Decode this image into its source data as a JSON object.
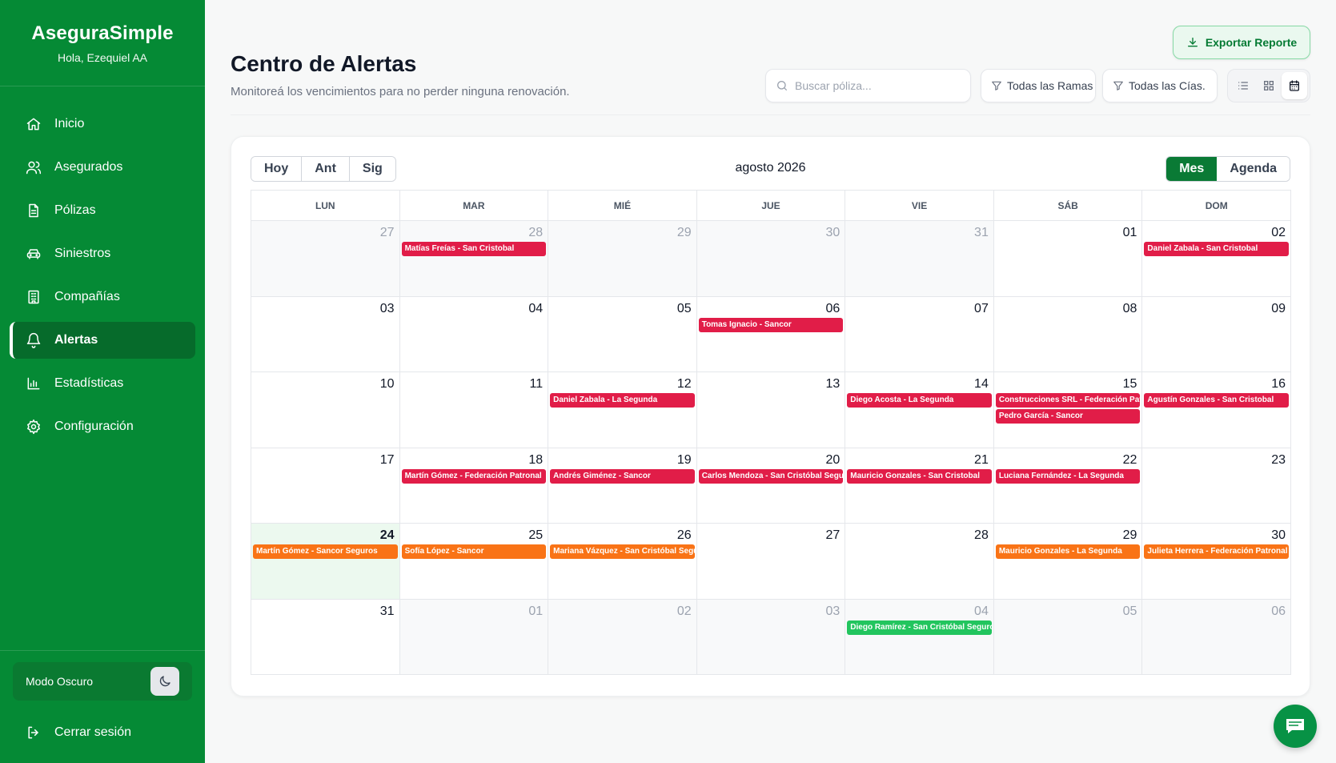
{
  "sidebar": {
    "brand": "AseguraSimple",
    "greeting": "Hola, Ezequiel AA",
    "items": [
      {
        "label": "Inicio",
        "icon": "home-icon"
      },
      {
        "label": "Asegurados",
        "icon": "users-icon"
      },
      {
        "label": "Pólizas",
        "icon": "document-icon"
      },
      {
        "label": "Siniestros",
        "icon": "car-icon"
      },
      {
        "label": "Compañías",
        "icon": "building-icon"
      },
      {
        "label": "Alertas",
        "icon": "bell-icon",
        "active": true
      },
      {
        "label": "Estadísticas",
        "icon": "bar-chart-icon"
      },
      {
        "label": "Configuración",
        "icon": "gear-icon"
      }
    ],
    "dark_mode_label": "Modo Oscuro",
    "logout_label": "Cerrar sesión"
  },
  "header": {
    "title": "Centro de Alertas",
    "subtitle": "Monitoreá los vencimientos para no perder ninguna renovación.",
    "export_label": "Exportar Reporte"
  },
  "toolbar": {
    "search_placeholder": "Buscar póliza...",
    "filter_ramas": "Todas las Ramas",
    "filter_cias": "Todas las Cías.",
    "views": [
      "list-view-icon",
      "grid-view-icon",
      "calendar-view-icon"
    ],
    "active_view": "calendar-view-icon"
  },
  "calendar": {
    "today_label": "Hoy",
    "prev_label": "Ant",
    "next_label": "Sig",
    "title": "agosto 2026",
    "mode_month": "Mes",
    "mode_agenda": "Agenda",
    "active_mode": "Mes",
    "weekdays": [
      "LUN",
      "MAR",
      "MIÉ",
      "JUE",
      "VIE",
      "SÁB",
      "DOM"
    ],
    "colors": {
      "red": "#e11d48",
      "orange": "#f97316",
      "green": "#22c55e"
    },
    "weeks": [
      [
        {
          "num": "27",
          "off": true,
          "events": []
        },
        {
          "num": "28",
          "off": true,
          "events": [
            {
              "label": "Matías Freías - San Cristobal",
              "color": "red"
            }
          ]
        },
        {
          "num": "29",
          "off": true,
          "events": []
        },
        {
          "num": "30",
          "off": true,
          "events": []
        },
        {
          "num": "31",
          "off": true,
          "events": []
        },
        {
          "num": "01",
          "events": []
        },
        {
          "num": "02",
          "events": [
            {
              "label": "Daniel Zabala - San Cristobal",
              "color": "red"
            }
          ]
        }
      ],
      [
        {
          "num": "03",
          "events": []
        },
        {
          "num": "04",
          "events": []
        },
        {
          "num": "05",
          "events": []
        },
        {
          "num": "06",
          "events": [
            {
              "label": "Tomas Ignacio - Sancor",
              "color": "red"
            }
          ]
        },
        {
          "num": "07",
          "events": []
        },
        {
          "num": "08",
          "events": []
        },
        {
          "num": "09",
          "events": []
        }
      ],
      [
        {
          "num": "10",
          "events": []
        },
        {
          "num": "11",
          "events": []
        },
        {
          "num": "12",
          "events": [
            {
              "label": "Daniel Zabala - La Segunda",
              "color": "red"
            }
          ]
        },
        {
          "num": "13",
          "events": []
        },
        {
          "num": "14",
          "events": [
            {
              "label": "Diego Acosta - La Segunda",
              "color": "red"
            }
          ]
        },
        {
          "num": "15",
          "events": [
            {
              "label": "Construcciones SRL - Federación Patronal",
              "color": "red"
            },
            {
              "label": "Pedro García - Sancor",
              "color": "red"
            }
          ]
        },
        {
          "num": "16",
          "events": [
            {
              "label": "Agustín Gonzales - San Cristobal",
              "color": "red"
            }
          ]
        }
      ],
      [
        {
          "num": "17",
          "events": []
        },
        {
          "num": "18",
          "events": [
            {
              "label": "Martín Gómez - Federación Patronal",
              "color": "red"
            }
          ]
        },
        {
          "num": "19",
          "events": [
            {
              "label": "Andrés Giménez - Sancor",
              "color": "red"
            }
          ]
        },
        {
          "num": "20",
          "events": [
            {
              "label": "Carlos Mendoza - San Cristóbal Seguros",
              "color": "red"
            }
          ]
        },
        {
          "num": "21",
          "events": [
            {
              "label": "Mauricio Gonzales - San Cristobal",
              "color": "red"
            }
          ]
        },
        {
          "num": "22",
          "events": [
            {
              "label": "Luciana Fernández - La Segunda",
              "color": "red"
            }
          ]
        },
        {
          "num": "23",
          "events": []
        }
      ],
      [
        {
          "num": "24",
          "today": true,
          "events": [
            {
              "label": "Martín Gómez - Sancor Seguros",
              "color": "orange"
            }
          ]
        },
        {
          "num": "25",
          "events": [
            {
              "label": "Sofía López - Sancor",
              "color": "orange"
            }
          ]
        },
        {
          "num": "26",
          "events": [
            {
              "label": "Mariana Vázquez - San Cristóbal Seguros",
              "color": "orange"
            }
          ]
        },
        {
          "num": "27",
          "events": []
        },
        {
          "num": "28",
          "events": []
        },
        {
          "num": "29",
          "events": [
            {
              "label": "Mauricio Gonzales - La Segunda",
              "color": "orange"
            }
          ]
        },
        {
          "num": "30",
          "events": [
            {
              "label": "Julieta Herrera - Federación Patronal",
              "color": "orange"
            }
          ]
        }
      ],
      [
        {
          "num": "31",
          "events": []
        },
        {
          "num": "01",
          "off": true,
          "events": []
        },
        {
          "num": "02",
          "off": true,
          "events": []
        },
        {
          "num": "03",
          "off": true,
          "events": []
        },
        {
          "num": "04",
          "off": true,
          "events": [
            {
              "label": "Diego Ramírez - San Cristóbal Seguros",
              "color": "green"
            }
          ]
        },
        {
          "num": "05",
          "off": true,
          "events": []
        },
        {
          "num": "06",
          "off": true,
          "events": []
        }
      ]
    ]
  },
  "chat": {
    "icon": "chat-icon"
  }
}
